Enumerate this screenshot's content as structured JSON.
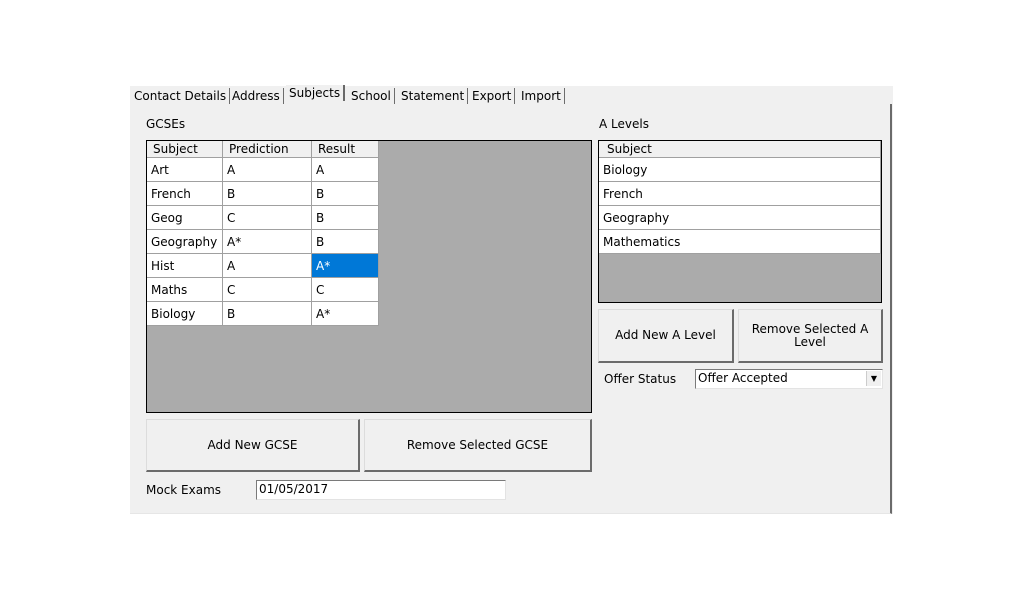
{
  "tabs": [
    {
      "label": "Contact Details",
      "active": false
    },
    {
      "label": "Address",
      "active": false
    },
    {
      "label": "Subjects",
      "active": true
    },
    {
      "label": "School",
      "active": false
    },
    {
      "label": "Statement",
      "active": false
    },
    {
      "label": "Export",
      "active": false
    },
    {
      "label": "Import",
      "active": false
    }
  ],
  "gcse": {
    "title": "GCSEs",
    "columns": [
      "Subject",
      "Prediction",
      "Result"
    ],
    "rows": [
      {
        "subject": "Art",
        "prediction": "A",
        "result": "A"
      },
      {
        "subject": "French",
        "prediction": "B",
        "result": "B"
      },
      {
        "subject": "Geog",
        "prediction": "C",
        "result": "B"
      },
      {
        "subject": "Geography",
        "prediction": "A*",
        "result": "B"
      },
      {
        "subject": "Hist",
        "prediction": "A",
        "result": "A*",
        "selected_cell": "result"
      },
      {
        "subject": "Maths",
        "prediction": "C",
        "result": "C"
      },
      {
        "subject": "Biology",
        "prediction": "B",
        "result": "A*"
      }
    ],
    "add_button": "Add New GCSE",
    "remove_button": "Remove Selected GCSE",
    "mock_exams_label": "Mock Exams",
    "mock_exams_value": "01/05/2017"
  },
  "alevels": {
    "title": "A Levels",
    "columns": [
      "Subject"
    ],
    "rows": [
      "Biology",
      "French",
      "Geography",
      "Mathematics"
    ],
    "add_button": "Add New A Level",
    "remove_button": "Remove Selected A Level",
    "offer_status_label": "Offer Status",
    "offer_status_value": "Offer Accepted"
  },
  "colors": {
    "selection": "#0078d7",
    "grid_background": "#ababab",
    "panel": "#f0f0f0"
  }
}
